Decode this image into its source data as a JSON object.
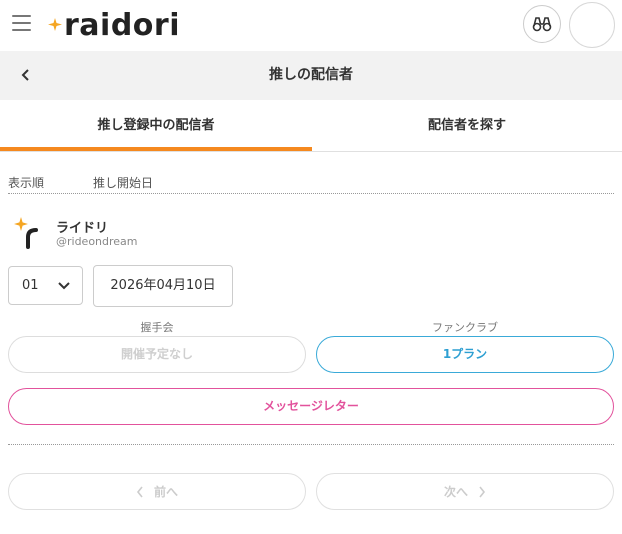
{
  "header": {
    "logo_text": "raidori",
    "menu_icon": "hamburger-menu-icon",
    "search_icon": "binoculars-icon",
    "brand_color": "#f5a623"
  },
  "subbar": {
    "title": "推しの配信者",
    "back_icon": "chevron-left-icon"
  },
  "tabs": [
    {
      "label": "推し登録中の配信者",
      "active": true
    },
    {
      "label": "配信者を探す",
      "active": false
    }
  ],
  "tab_accent": "#f5891f",
  "sort": {
    "label": "表示順",
    "value": "推し開始日"
  },
  "streamer": {
    "name": "ライドリ",
    "handle": "@rideondream",
    "order": "01",
    "start_date": "2026年04月10日",
    "handshake_label": "握手会",
    "handshake_status": "開催予定なし",
    "fanclub_label": "ファンクラブ",
    "fanclub_plans": "1プラン",
    "letter_button": "メッセージレター"
  },
  "colors": {
    "fanclub": "#2d9fd2",
    "letter": "#e2529c"
  },
  "pagination": {
    "prev": "前へ",
    "next": "次へ"
  }
}
